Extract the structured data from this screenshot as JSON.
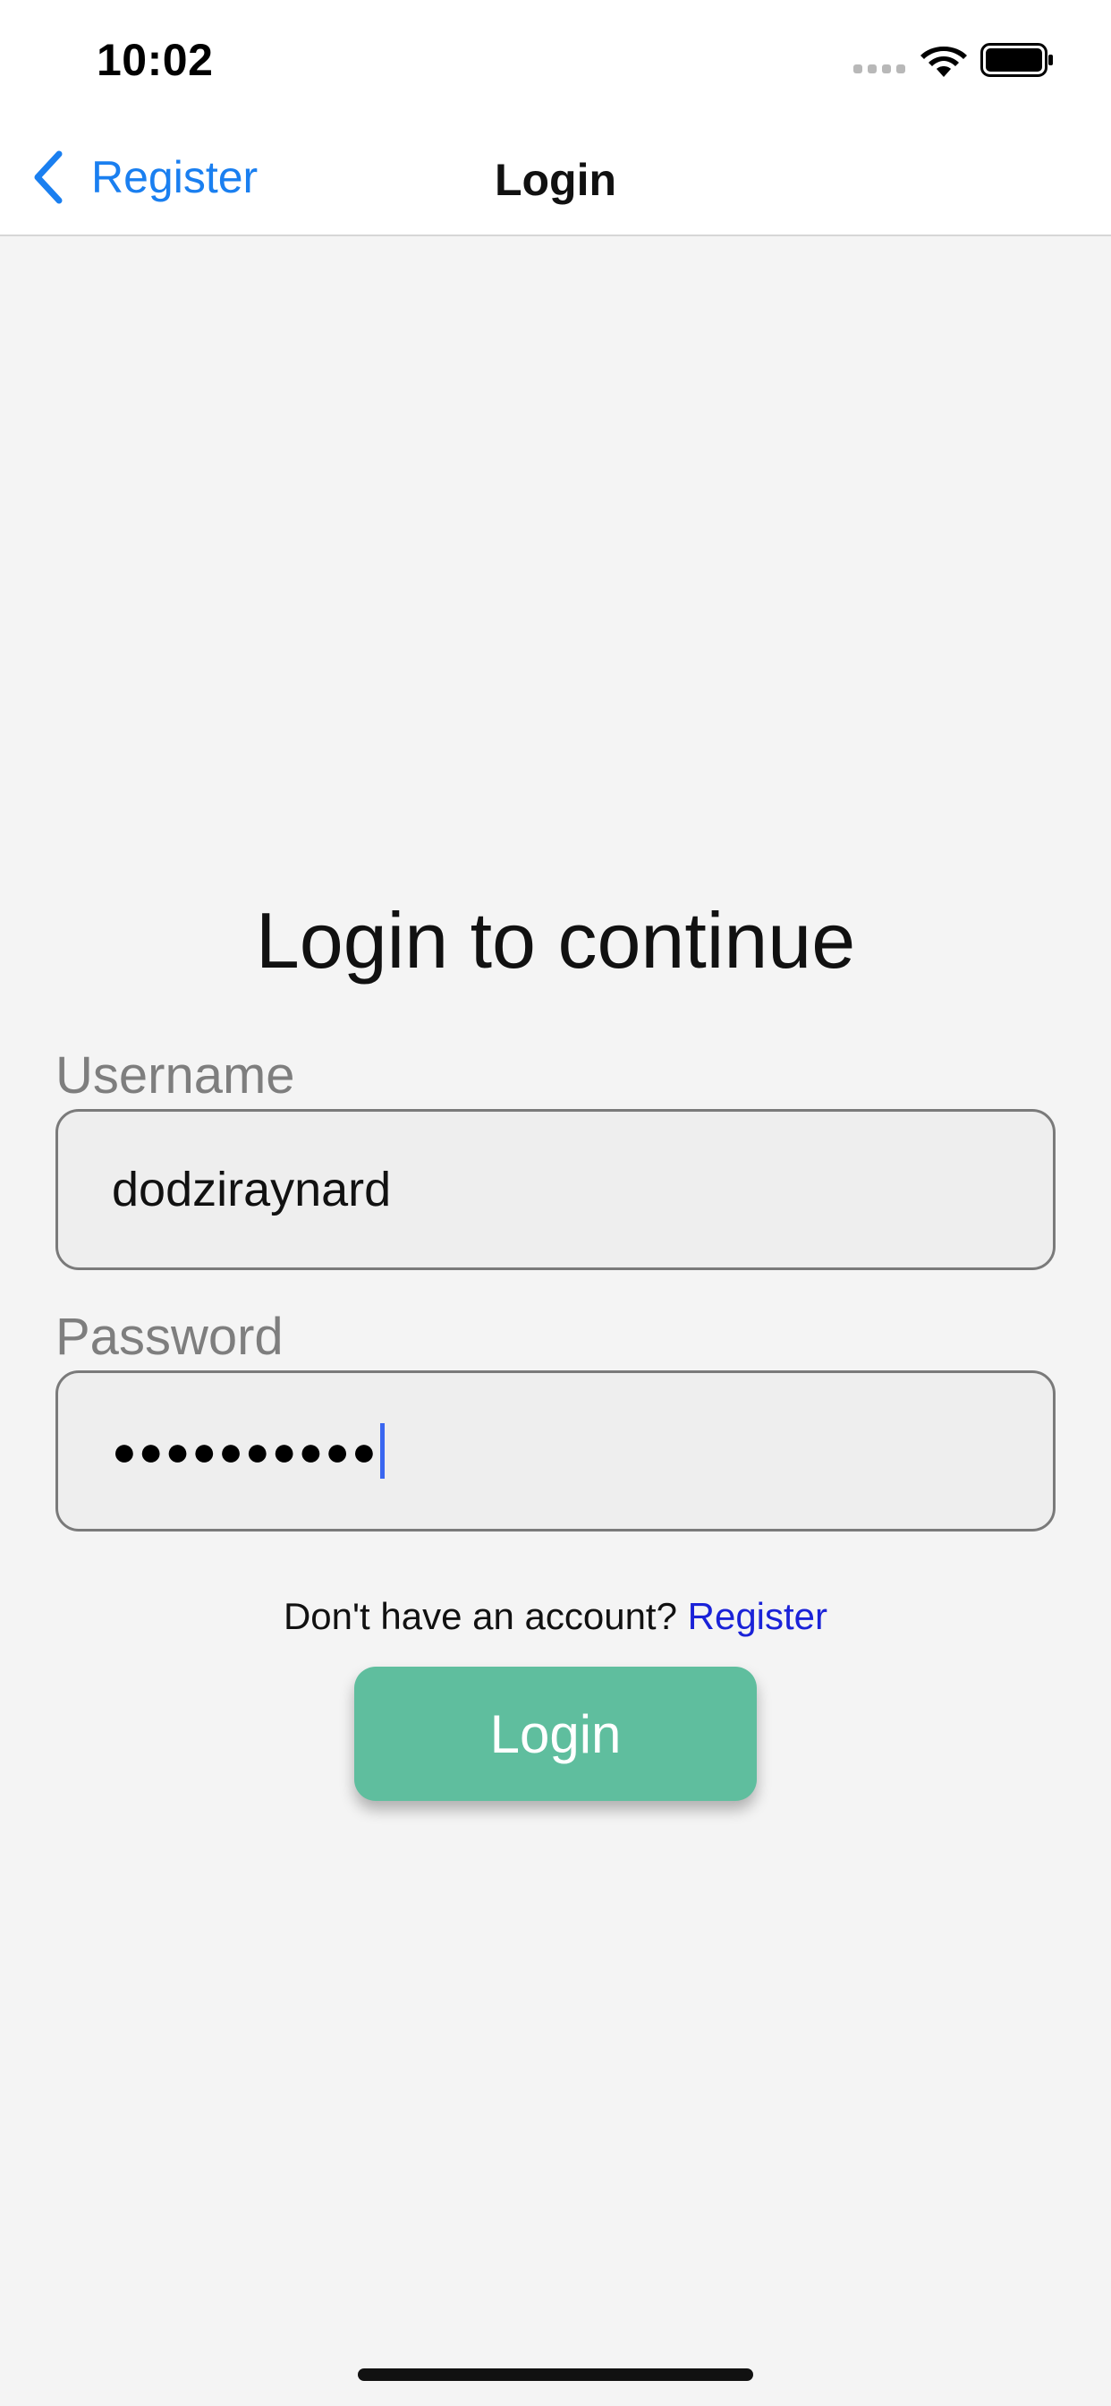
{
  "status_bar": {
    "time": "10:02",
    "icons": [
      "cellular-signal-icon",
      "wifi-icon",
      "battery-icon"
    ]
  },
  "nav_bar": {
    "back_label": "Register",
    "back_icon": "chevron-left-icon",
    "title": "Login"
  },
  "form": {
    "heading": "Login to continue",
    "username_label": "Username",
    "username_value": "dodziraynard",
    "password_label": "Password",
    "password_value": "●●●●●●●●●●",
    "register_prompt": "Don't have an account?",
    "register_link": "Register",
    "login_button": "Login"
  },
  "colors": {
    "accent_blue": "#1a7ff0",
    "link_blue": "#1a22d8",
    "button_green": "#5fbe9e",
    "background": "#f4f4f4",
    "caret": "#3a66f0"
  }
}
